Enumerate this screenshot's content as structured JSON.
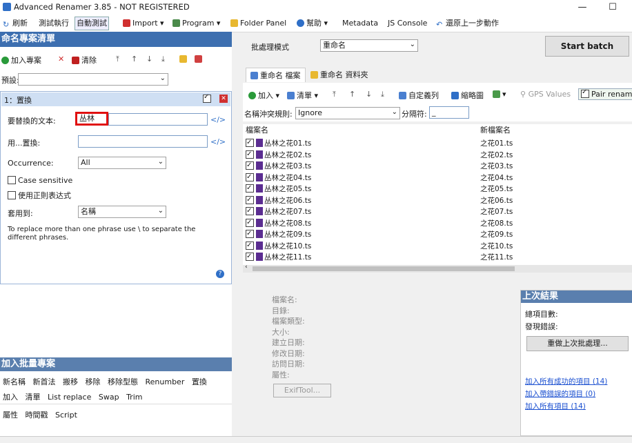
{
  "window": {
    "title": "Advanced Renamer 3.85 - NOT REGISTERED",
    "minimize": "—",
    "maximize": "☐"
  },
  "toolbar": {
    "refresh": "刷新",
    "test_run": "測試執行",
    "auto_test": "自動測試",
    "import": "Import ▾",
    "program": "Program ▾",
    "folder_panel": "Folder Panel",
    "help": "幫助 ▾",
    "metadata": "Metadata",
    "js_console": "JS Console",
    "undo": "還原上一步動作"
  },
  "left": {
    "title": "命名專案清單",
    "add_method": "加入專案",
    "clear": "清除",
    "preset_label": "預設:",
    "preset_value": "",
    "method": {
      "title": "1：置換",
      "find_label": "要替換的文本:",
      "find_value": "丛林",
      "replace_label": "用...置換:",
      "replace_value": "",
      "occurrence_label": "Occurrence:",
      "occurrence_value": "All",
      "case_sensitive": "Case sensitive",
      "regex": "使用正則表达式",
      "apply_label": "套用到:",
      "apply_value": "名稱",
      "hint": "To replace more than one phrase use \\ to separate the different phrases."
    },
    "batch_title": "加入批量專案",
    "batch_row1": [
      "新名稱",
      "新首法",
      "搬移",
      "移除",
      "移除型態",
      "Renumber",
      "置換"
    ],
    "batch_row2": [
      "加入",
      "清單",
      "List replace",
      "Swap",
      "Trim"
    ],
    "batch_row3": [
      "屬性",
      "時間戳",
      "Script"
    ]
  },
  "right": {
    "batch_mode_label": "批處理模式",
    "batch_mode_value": "重命名",
    "start_batch": "Start batch",
    "tab_files": "重命名 檔案",
    "tab_folders": "重命名 資料夾",
    "add": "加入 ▾",
    "list": "清單 ▾",
    "custom_cols": "自定義列",
    "thumbnails": "縮略圖",
    "gps": "GPS Values",
    "pair": "Pair renam",
    "conflict_label": "名稱沖突規則:",
    "conflict_value": "Ignore",
    "separator_label": "分隔符:",
    "separator_value": "_",
    "col_name": "檔案名",
    "col_new": "新檔案名",
    "files": [
      {
        "name": "丛林之花01.ts",
        "new": "之花01.ts"
      },
      {
        "name": "丛林之花02.ts",
        "new": "之花02.ts"
      },
      {
        "name": "丛林之花03.ts",
        "new": "之花03.ts"
      },
      {
        "name": "丛林之花04.ts",
        "new": "之花04.ts"
      },
      {
        "name": "丛林之花05.ts",
        "new": "之花05.ts"
      },
      {
        "name": "丛林之花06.ts",
        "new": "之花06.ts"
      },
      {
        "name": "丛林之花07.ts",
        "new": "之花07.ts"
      },
      {
        "name": "丛林之花08.ts",
        "new": "之花08.ts"
      },
      {
        "name": "丛林之花09.ts",
        "new": "之花09.ts"
      },
      {
        "name": "丛林之花10.ts",
        "new": "之花10.ts"
      },
      {
        "name": "丛林之花11.ts",
        "new": "之花11.ts"
      }
    ],
    "info": [
      "檔案名:",
      "目錄:",
      "檔案類型:",
      "大小:",
      "建立日期:",
      "修改日期:",
      "訪問日期:",
      "屬性:"
    ],
    "exiftool": "ExifTool...",
    "last": {
      "title": "上次結果",
      "total": "總項目數:",
      "errors": "發現錯誤:",
      "redo": "重做上次批處理...",
      "link1": "加入所有成功的項目 (14)",
      "link2": "加入帶錯誤的項目 (0)",
      "link3": "加入所有項目 (14)"
    }
  }
}
